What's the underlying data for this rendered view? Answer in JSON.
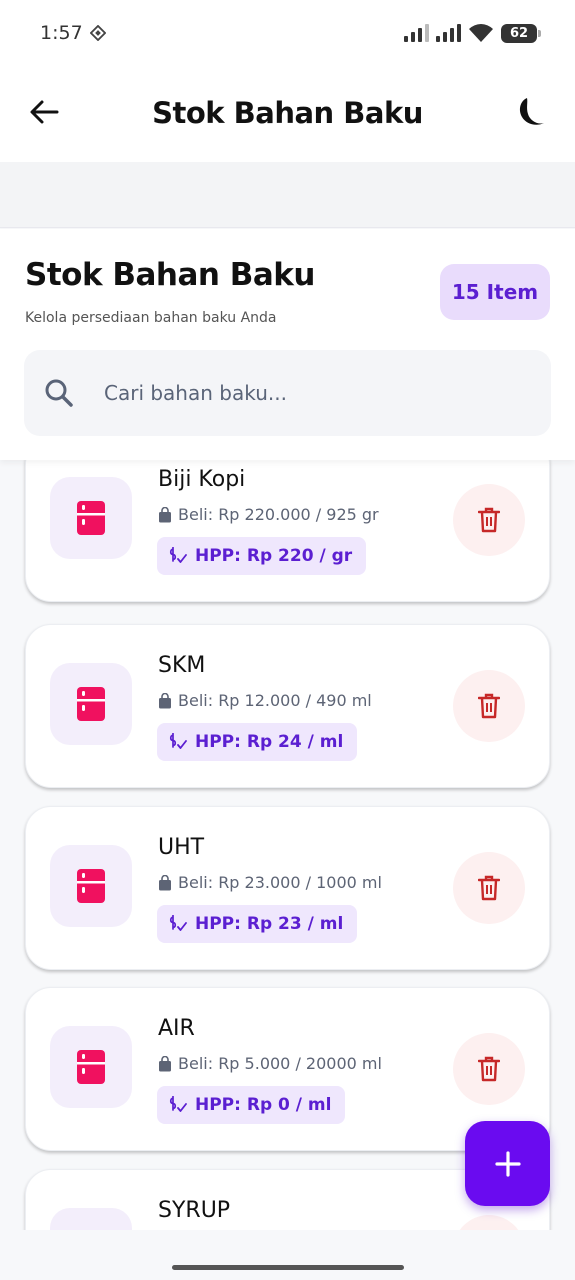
{
  "status_bar": {
    "time": "1:57",
    "battery": "62"
  },
  "app_bar": {
    "title": "Stok Bahan Baku",
    "back_icon": "arrow-left-icon",
    "theme_icon": "moon-icon"
  },
  "header": {
    "title": "Stok Bahan Baku",
    "subtitle": "Kelola persediaan bahan baku Anda",
    "count_badge": "15 Item"
  },
  "search": {
    "placeholder": "Cari bahan baku...",
    "value": ""
  },
  "items": [
    {
      "name": "Biji Kopi",
      "beli": "Beli: Rp 220.000 / 925 gr",
      "hpp": "HPP: Rp 220 / gr"
    },
    {
      "name": "SKM",
      "beli": "Beli: Rp 12.000 / 490 ml",
      "hpp": "HPP: Rp 24 / ml"
    },
    {
      "name": "UHT",
      "beli": "Beli: Rp 23.000 / 1000 ml",
      "hpp": "HPP: Rp 23 / ml"
    },
    {
      "name": "AIR",
      "beli": "Beli: Rp 5.000 / 20000 ml",
      "hpp": "HPP: Rp 0 / ml"
    },
    {
      "name": "SYRUP",
      "beli": "",
      "hpp": ""
    }
  ],
  "colors": {
    "accent": "#6a0bf0",
    "badge_bg": "#e9dcfc",
    "icon_pink": "#f0115f",
    "delete_red": "#c62828"
  },
  "icons": {
    "item": "fridge-icon",
    "bag": "shopping-bag-icon",
    "hpp": "price-tag-icon",
    "delete": "trash-icon",
    "add": "plus-icon",
    "search": "search-icon"
  }
}
